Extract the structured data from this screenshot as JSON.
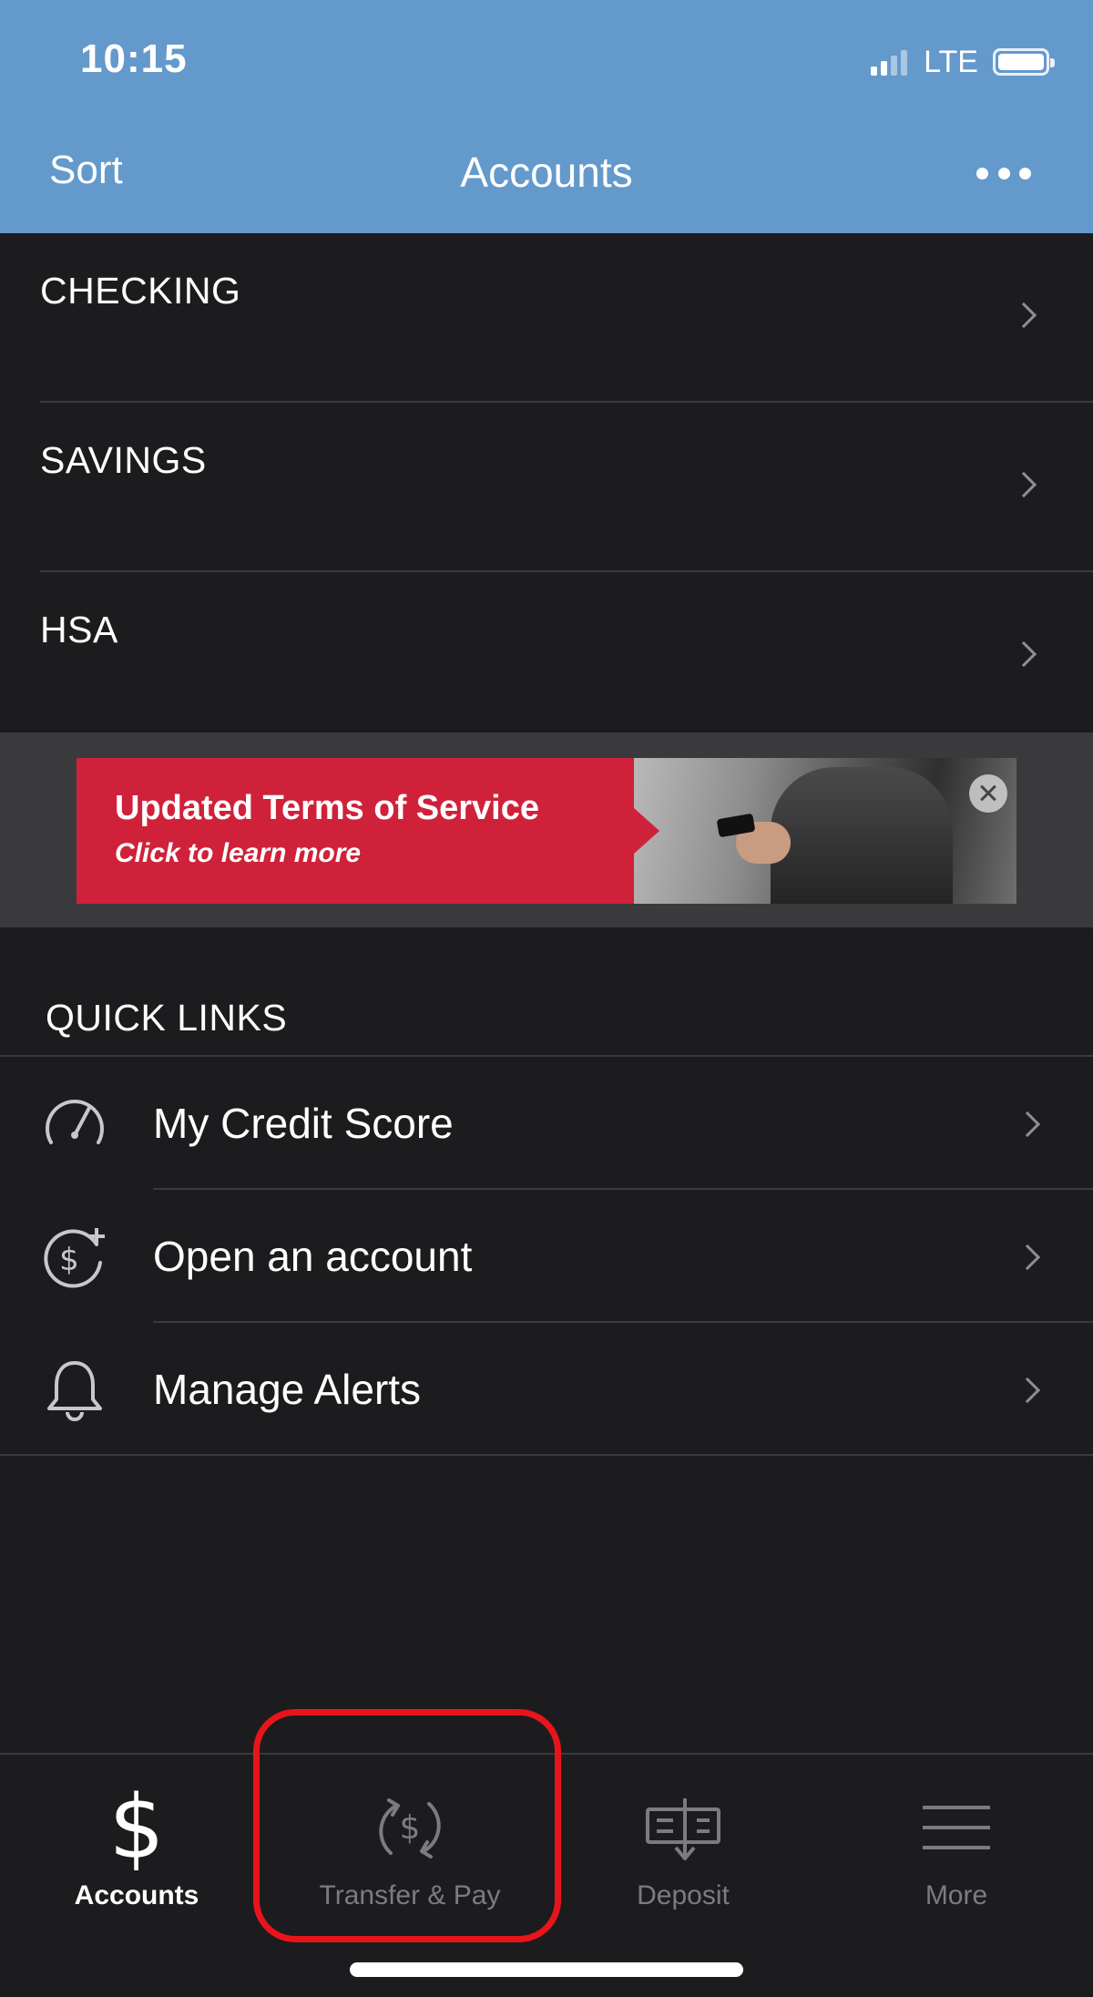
{
  "status_bar": {
    "time": "10:15",
    "network": "LTE",
    "signal_bars": 2,
    "battery_level": 0.9
  },
  "nav_bar": {
    "left_label": "Sort",
    "title": "Accounts",
    "more_icon": "ellipsis-icon",
    "background_color": "#6499cc"
  },
  "accounts": [
    {
      "label": "CHECKING"
    },
    {
      "label": "SAVINGS"
    },
    {
      "label": "HSA"
    }
  ],
  "banner": {
    "title": "Updated Terms of Service",
    "subtitle": "Click to learn more",
    "color": "#d0213a",
    "close_icon": "close-icon"
  },
  "quick_links": {
    "heading": "QUICK LINKS",
    "items": [
      {
        "label": "My Credit Score",
        "icon": "gauge-icon"
      },
      {
        "label": "Open an account",
        "icon": "dollar-plus-icon"
      },
      {
        "label": "Manage Alerts",
        "icon": "bell-icon"
      }
    ]
  },
  "tab_bar": {
    "tabs": [
      {
        "label": "Accounts",
        "icon": "dollar-icon",
        "active": true
      },
      {
        "label": "Transfer & Pay",
        "icon": "transfer-dollar-icon",
        "active": false
      },
      {
        "label": "Deposit",
        "icon": "check-deposit-icon",
        "active": false
      },
      {
        "label": "More",
        "icon": "menu-icon",
        "active": false
      }
    ],
    "highlighted_tab": "Transfer & Pay",
    "highlight_color": "#e8141c"
  }
}
